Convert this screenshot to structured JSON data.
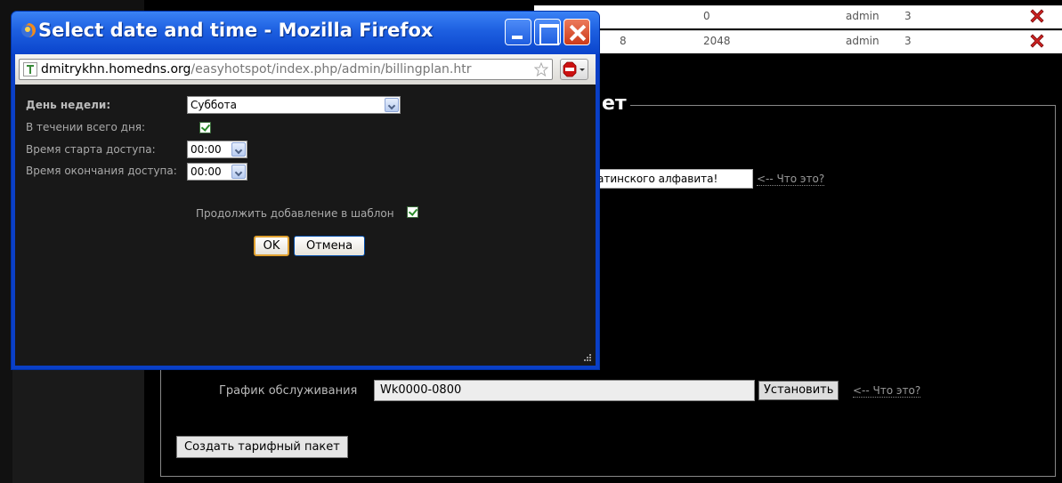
{
  "window": {
    "title": "Select date and time - Mozilla Firefox",
    "url_host": "dmitrykhn.homedns.org",
    "url_path": "/easyhotspot/index.php/admin/billingplan.htr"
  },
  "dialog": {
    "day_label": "День недели:",
    "day_value": "Суббота",
    "allday_label": "В течении всего дня:",
    "start_label": "Время старта доступа:",
    "start_value": "00:00",
    "end_label": "Время окончания доступа:",
    "end_value": "00:00",
    "continue_label": "Продолжить добавление в шаблон",
    "ok_label": "OK",
    "cancel_label": "Отмена"
  },
  "table": {
    "rows": [
      {
        "id": "",
        "speed": "0",
        "user": "admin",
        "num": "3"
      },
      {
        "id": "8",
        "speed": "2048",
        "user": "admin",
        "num": "3"
      }
    ]
  },
  "form": {
    "legend": "ет",
    "name_value": "атинского алфавита!",
    "whatis_label": "<-- Что это?",
    "schedule_label": "График обслуживания",
    "schedule_value": "Wk0000-0800",
    "set_button": "Установить",
    "create_button": "Создать тарифный пакет"
  },
  "colors": {
    "titlebar": "#1d5fe0",
    "close_button": "#cc3a1a",
    "dialog_bg": "#181818",
    "delete_icon": "#cc2222"
  },
  "icons": [
    "firefox-icon",
    "site-icon",
    "bookmark-star-icon",
    "adblock-icon",
    "delete-icon",
    "resize-grip-icon"
  ]
}
